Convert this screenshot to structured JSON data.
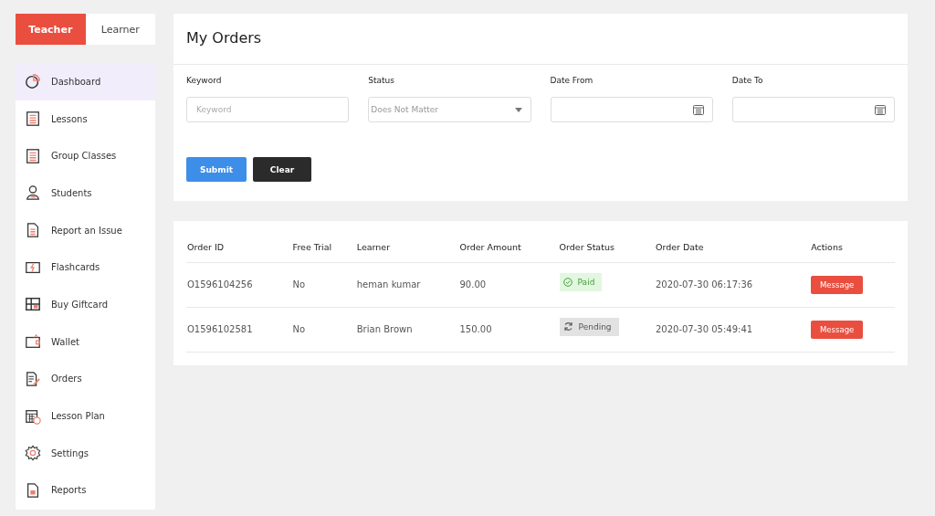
{
  "role_tabs": [
    {
      "label": "Teacher",
      "selected": true
    },
    {
      "label": "Learner",
      "selected": false
    }
  ],
  "sidebar": {
    "items": [
      {
        "label": "Dashboard",
        "selected": true
      },
      {
        "label": "Lessons",
        "selected": false
      },
      {
        "label": "Group Classes",
        "selected": false
      },
      {
        "label": "Students",
        "selected": false
      },
      {
        "label": "Report an Issue",
        "selected": false
      },
      {
        "label": "Flashcards",
        "selected": false
      },
      {
        "label": "Buy Giftcard",
        "selected": false
      },
      {
        "label": "Wallet",
        "selected": false
      },
      {
        "label": "Orders",
        "selected": false
      },
      {
        "label": "Lesson Plan",
        "selected": false
      },
      {
        "label": "Settings",
        "selected": false
      },
      {
        "label": "Reports",
        "selected": false
      }
    ]
  },
  "page_title": "My Orders",
  "filters": [
    {
      "kind": "text",
      "label": "Keyword",
      "placeholder": "Keyword"
    },
    {
      "kind": "select",
      "label": "Status",
      "value": "Does Not Matter"
    },
    {
      "kind": "date",
      "label": "Date From"
    },
    {
      "kind": "date",
      "label": "Date To"
    }
  ],
  "buttons": [
    {
      "kind": "primary",
      "label": "Submit"
    },
    {
      "kind": "dark",
      "label": "Clear"
    }
  ],
  "table": {
    "columns": [
      "Order ID",
      "Free Trial",
      "Learner",
      "Order Amount",
      "Order Status",
      "Order Date",
      "Actions"
    ],
    "rows": [
      {
        "order_id": "O1596104256",
        "free_trial": "No",
        "learner": "heman kumar",
        "amount": "90.00",
        "status": {
          "kind": "paid",
          "label": "Paid"
        },
        "date": "2020-07-30 06:17:36",
        "action": "Message"
      },
      {
        "order_id": "O1596102581",
        "free_trial": "No",
        "learner": "Brian Brown",
        "amount": "150.00",
        "status": {
          "kind": "pending",
          "label": "Pending"
        },
        "date": "2020-07-30 05:49:41",
        "action": "Message"
      }
    ]
  }
}
